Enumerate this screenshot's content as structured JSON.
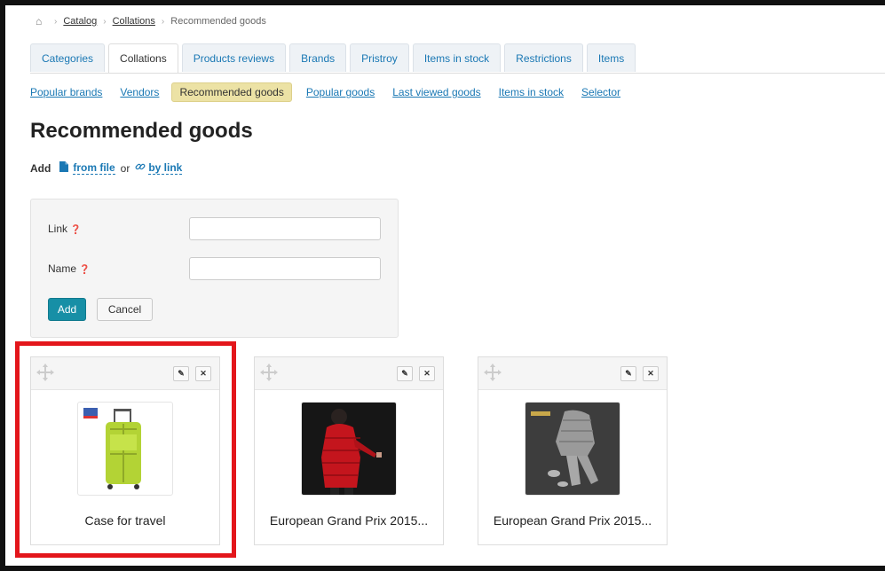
{
  "breadcrumb": {
    "items": [
      "Catalog",
      "Collations"
    ],
    "current": "Recommended goods"
  },
  "tabs": [
    "Categories",
    "Collations",
    "Products reviews",
    "Brands",
    "Pristroy",
    "Items in stock",
    "Restrictions",
    "Items"
  ],
  "active_tab": "Collations",
  "subtabs": [
    "Popular brands",
    "Vendors",
    "Recommended goods",
    "Popular goods",
    "Last viewed goods",
    "Items in stock",
    "Selector"
  ],
  "active_subtab": "Recommended goods",
  "page_title": "Recommended goods",
  "add_line": {
    "label": "Add",
    "from_file": "from file",
    "or": "or",
    "by_link": "by link"
  },
  "form": {
    "link_label": "Link",
    "name_label": "Name",
    "link_value": "",
    "name_value": "",
    "add_button": "Add",
    "cancel_button": "Cancel"
  },
  "products": [
    {
      "title": "Case for travel",
      "image": "green-suitcase",
      "highlighted": true
    },
    {
      "title": "European Grand Prix 2015...",
      "image": "red-puffer-jacket",
      "highlighted": false
    },
    {
      "title": "European Grand Prix 2015...",
      "image": "grey-clothes-flatlay",
      "highlighted": false
    }
  ],
  "colors": {
    "accent": "#1a78b4",
    "primary_button": "#178fa6",
    "active_subtab": "#ece2a5",
    "highlight": "#e3161b"
  }
}
